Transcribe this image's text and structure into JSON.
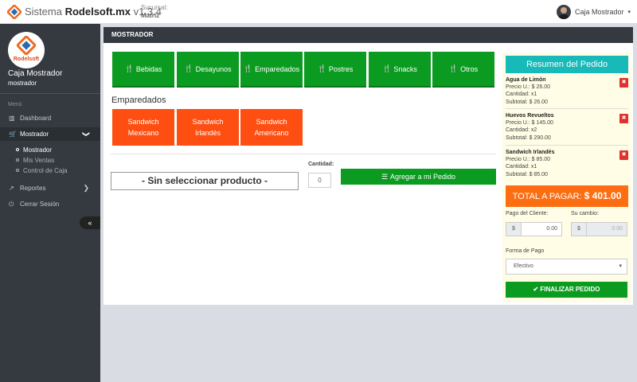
{
  "header": {
    "app_title_prefix": "Sistema",
    "app_title_brand": "Rodelsoft.mx",
    "app_version": "v1.3.4",
    "sucursal_label": "Sucursal:",
    "sucursal_value": "Matriz",
    "user_name": "Caja Mostrador",
    "caret": "▾"
  },
  "sidebar": {
    "brand_logo_text": "Rodelsoft",
    "user_name": "Caja Mostrador",
    "user_role": "mostrador",
    "menu_header": "Menú",
    "items": [
      {
        "icon": "▥",
        "label": "Dashboard"
      },
      {
        "icon": "🛒",
        "label": "Mostrador",
        "chevron": "❯"
      },
      {
        "icon": "↗",
        "label": "Reportes",
        "chevron": "❯"
      },
      {
        "icon": "⏻",
        "label": "Cerrar Sesión"
      }
    ],
    "sub_items": [
      "Mostrador",
      "Mis Ventas",
      "Control de Caja"
    ],
    "collapse_icon": "«"
  },
  "main": {
    "card_title": "MOSTRADOR",
    "category_icon": "🍴",
    "categories": [
      "Bebidas",
      "Desayunos",
      "Emparedados",
      "Postres",
      "Snacks",
      "Otros"
    ],
    "section_title": "Emparedados",
    "products": [
      "Sandwich Mexicano",
      "Sandwich Irlandés",
      "Sandwich Americano"
    ],
    "selected_product": "- Sin seleccionar producto -",
    "quantity_label": "Cantidad:",
    "quantity_value": "0",
    "add_icon": "☰",
    "add_button": "Agregar a mi Pedido"
  },
  "order": {
    "title": "Resumen del Pedido",
    "delete_icon": "✖",
    "items": [
      {
        "name": "Agua de Limón",
        "price": "Precio U.: $ 26.00",
        "qty": "Cantidad: x1",
        "subtotal": "Subtotal: $ 26.00"
      },
      {
        "name": "Huevos Revueltos",
        "price": "Precio U.: $ 145.00",
        "qty": "Cantidad: x2",
        "subtotal": "Subtotal: $ 290.00"
      },
      {
        "name": "Sandwich Irlandés",
        "price": "Precio U.: $ 85.00",
        "qty": "Cantidad: x1",
        "subtotal": "Subtotal: $ 85.00"
      }
    ],
    "total_label": "TOTAL A PAGAR:",
    "total_value": "$ 401.00",
    "payment_label": "Pago del Cliente:",
    "change_label": "Su cambio:",
    "currency": "$",
    "payment_value": "0.00",
    "change_value": "0.00",
    "payment_method_label": "Forma de Pago",
    "payment_method_value": "Efectivo",
    "select_arrow": "▾",
    "finish_icon": "✔",
    "finish_button": "FINALIZAR PEDIDO"
  },
  "colors": {
    "green": "#0b9b20",
    "orange": "#fe4e11",
    "teal": "#17b9b9",
    "total_orange": "#fd6e12",
    "sidebar": "#343a40"
  }
}
